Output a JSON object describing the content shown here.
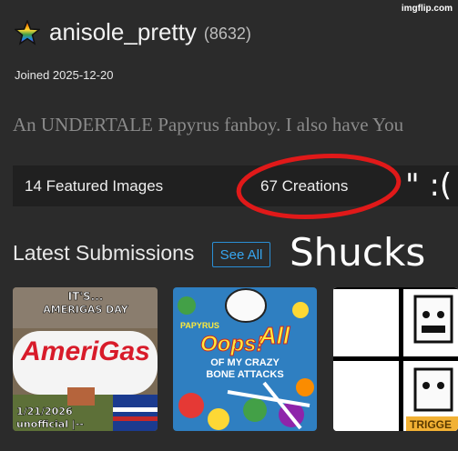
{
  "watermark": "imgflip.com",
  "profile": {
    "username": "anisole_pretty",
    "points": "(8632)",
    "joined": "Joined 2025-12-20",
    "bio": "An UNDERTALE Papyrus fanboy. I also have You"
  },
  "tabs": [
    {
      "label": "14 Featured Images"
    },
    {
      "label": "67 Creations"
    }
  ],
  "latest": {
    "heading": "Latest Submissions",
    "see_all": "See All"
  },
  "thumbs": [
    {
      "top": "IT'S...",
      "mid": "AMERIGAS DAY",
      "brand": "AmeriGas",
      "date": "1/21/2026",
      "note": "unofficial |--"
    },
    {
      "brand": "PAPYRUS",
      "oops": "Oops!",
      "all": "All",
      "sub1": "OF MY CRAZY",
      "sub2": "BONE ATTACKS"
    },
    {
      "label": "TRIGGE"
    }
  ],
  "annotations": {
    "face": "\"  :(",
    "text": "Shucks"
  },
  "colors": {
    "accent": "#2a8fd6",
    "circle": "#e01919",
    "background": "#2b2b2b"
  }
}
